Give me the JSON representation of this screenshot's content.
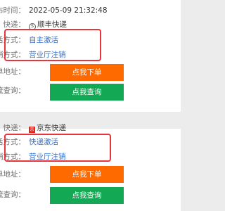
{
  "card1": {
    "publish_label": "发布时间：",
    "publish_time": "2022-05-09 21:32:48",
    "courier_label": "快递：",
    "courier_icon": "sf-express-icon",
    "courier_name": "顺丰快递",
    "activation_label": "激活方式：",
    "activation_value": "自主激活",
    "cancel_label": "注销方式：",
    "cancel_value": "营业厅注销",
    "order_label": "下单地址：",
    "order_button": "点我下单",
    "tracking_label": "物流查询：",
    "tracking_button": "点我查询"
  },
  "card2": {
    "courier_label": "快递：",
    "courier_icon": "jd-express-icon",
    "courier_name": "京东快递",
    "activation_label": "激活方式：",
    "activation_value": "快递激活",
    "cancel_label": "注销方式：",
    "cancel_value": "营业厅注销",
    "order_label": "下单地址：",
    "order_button": "点我下单",
    "tracking_label": "物流查询：",
    "tracking_button": "点我查询"
  },
  "colors": {
    "highlight": "#e8343a",
    "order_button": "#ff6a00",
    "tracking_button": "#13a854",
    "link": "#2f6fd1"
  }
}
